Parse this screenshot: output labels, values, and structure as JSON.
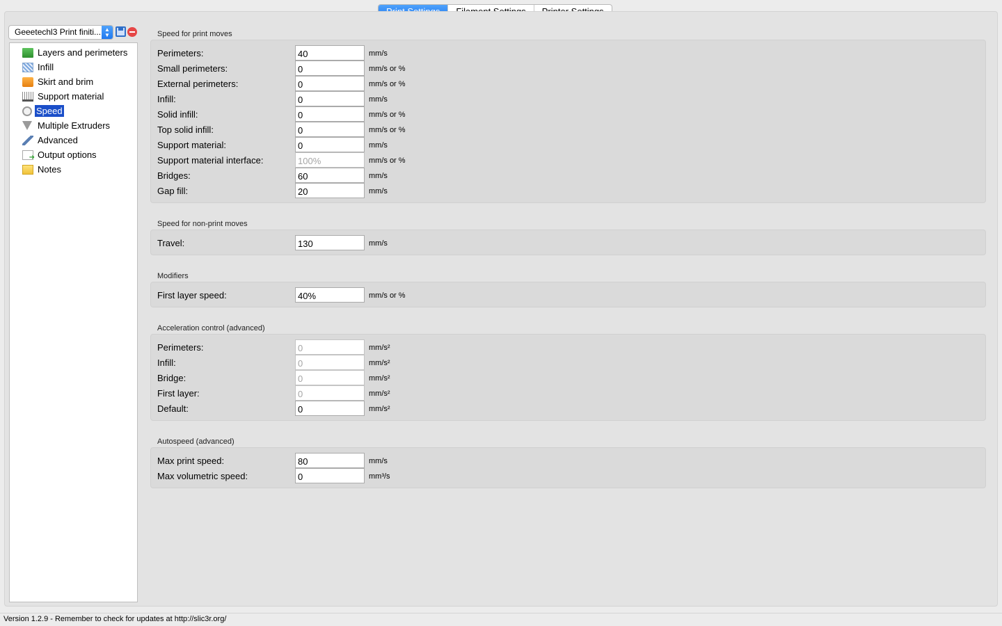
{
  "tabs": [
    "Print Settings",
    "Filament Settings",
    "Printer Settings"
  ],
  "preset": {
    "value": "Geeetechl3 Print finiti..."
  },
  "sidebar": {
    "items": [
      {
        "label": "Layers and perimeters",
        "icon": "layers-icon"
      },
      {
        "label": "Infill",
        "icon": "infill-icon"
      },
      {
        "label": "Skirt and brim",
        "icon": "skirt-brim-icon"
      },
      {
        "label": "Support material",
        "icon": "support-material-icon"
      },
      {
        "label": "Speed",
        "icon": "speed-icon",
        "selected": true
      },
      {
        "label": "Multiple Extruders",
        "icon": "funnel-icon"
      },
      {
        "label": "Advanced",
        "icon": "wrench-icon"
      },
      {
        "label": "Output options",
        "icon": "output-options-icon"
      },
      {
        "label": "Notes",
        "icon": "notes-icon"
      }
    ]
  },
  "groups": {
    "print_moves": {
      "title": "Speed for print moves",
      "fields": [
        {
          "label": "Perimeters:",
          "value": "40",
          "unit": "mm/s"
        },
        {
          "label": "Small perimeters:",
          "value": "0",
          "unit": "mm/s or %"
        },
        {
          "label": "External perimeters:",
          "value": "0",
          "unit": "mm/s or %"
        },
        {
          "label": "Infill:",
          "value": "0",
          "unit": "mm/s"
        },
        {
          "label": "Solid infill:",
          "value": "0",
          "unit": "mm/s or %"
        },
        {
          "label": "Top solid infill:",
          "value": "0",
          "unit": "mm/s or %"
        },
        {
          "label": "Support material:",
          "value": "0",
          "unit": "mm/s"
        },
        {
          "label": "Support material interface:",
          "value": "100%",
          "unit": "mm/s or %",
          "disabled": true
        },
        {
          "label": "Bridges:",
          "value": "60",
          "unit": "mm/s"
        },
        {
          "label": "Gap fill:",
          "value": "20",
          "unit": "mm/s"
        }
      ]
    },
    "non_print_moves": {
      "title": "Speed for non-print moves",
      "fields": [
        {
          "label": "Travel:",
          "value": "130",
          "unit": "mm/s"
        }
      ]
    },
    "modifiers": {
      "title": "Modifiers",
      "fields": [
        {
          "label": "First layer speed:",
          "value": "40%",
          "unit": "mm/s or %"
        }
      ]
    },
    "acceleration": {
      "title": "Acceleration control (advanced)",
      "fields": [
        {
          "label": "Perimeters:",
          "value": "0",
          "unit": "mm/s²",
          "disabled": true
        },
        {
          "label": "Infill:",
          "value": "0",
          "unit": "mm/s²",
          "disabled": true
        },
        {
          "label": "Bridge:",
          "value": "0",
          "unit": "mm/s²",
          "disabled": true
        },
        {
          "label": "First layer:",
          "value": "0",
          "unit": "mm/s²",
          "disabled": true
        },
        {
          "label": "Default:",
          "value": "0",
          "unit": "mm/s²"
        }
      ]
    },
    "autospeed": {
      "title": "Autospeed (advanced)",
      "fields": [
        {
          "label": "Max print speed:",
          "value": "80",
          "unit": "mm/s"
        },
        {
          "label": "Max volumetric speed:",
          "value": "0",
          "unit": "mm³/s"
        }
      ]
    }
  },
  "status": "Version 1.2.9 - Remember to check for updates at http://slic3r.org/"
}
